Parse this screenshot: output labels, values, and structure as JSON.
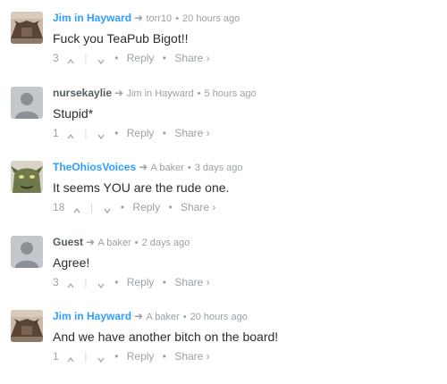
{
  "comments": [
    {
      "author": "Jim in Hayward",
      "author_style": "link",
      "avatar": "hayward-avatar",
      "reply_to": "torr10",
      "time": "20 hours ago",
      "text": "Fuck you TeaPub Bigot!!",
      "votes": "3",
      "reply_label": "Reply",
      "share_label": "Share ›"
    },
    {
      "author": "nursekaylie",
      "author_style": "plain",
      "avatar": "default-avatar",
      "reply_to": "Jim in Hayward",
      "time": "5 hours ago",
      "text": "Stupid*",
      "votes": "1",
      "reply_label": "Reply",
      "share_label": "Share ›"
    },
    {
      "author": "TheOhiosVoices",
      "author_style": "link",
      "avatar": "creature-avatar",
      "reply_to": "A baker",
      "time": "3 days ago",
      "text": "It seems YOU are the rude one.",
      "votes": "18",
      "reply_label": "Reply",
      "share_label": "Share ›"
    },
    {
      "author": "Guest",
      "author_style": "plain",
      "avatar": "default-avatar",
      "reply_to": "A baker",
      "time": "2 days ago",
      "text": "Agree!",
      "votes": "3",
      "reply_label": "Reply",
      "share_label": "Share ›"
    },
    {
      "author": "Jim in Hayward",
      "author_style": "link",
      "avatar": "hayward-avatar",
      "reply_to": "A baker",
      "time": "20 hours ago",
      "text": "And we have another bitch on the board!",
      "votes": "1",
      "reply_label": "Reply",
      "share_label": "Share ›"
    }
  ],
  "colors": {
    "link_author": "#2e9fff",
    "plain_author": "#555d61",
    "meta": "#9aa2a7",
    "text": "#2a2e2e"
  }
}
